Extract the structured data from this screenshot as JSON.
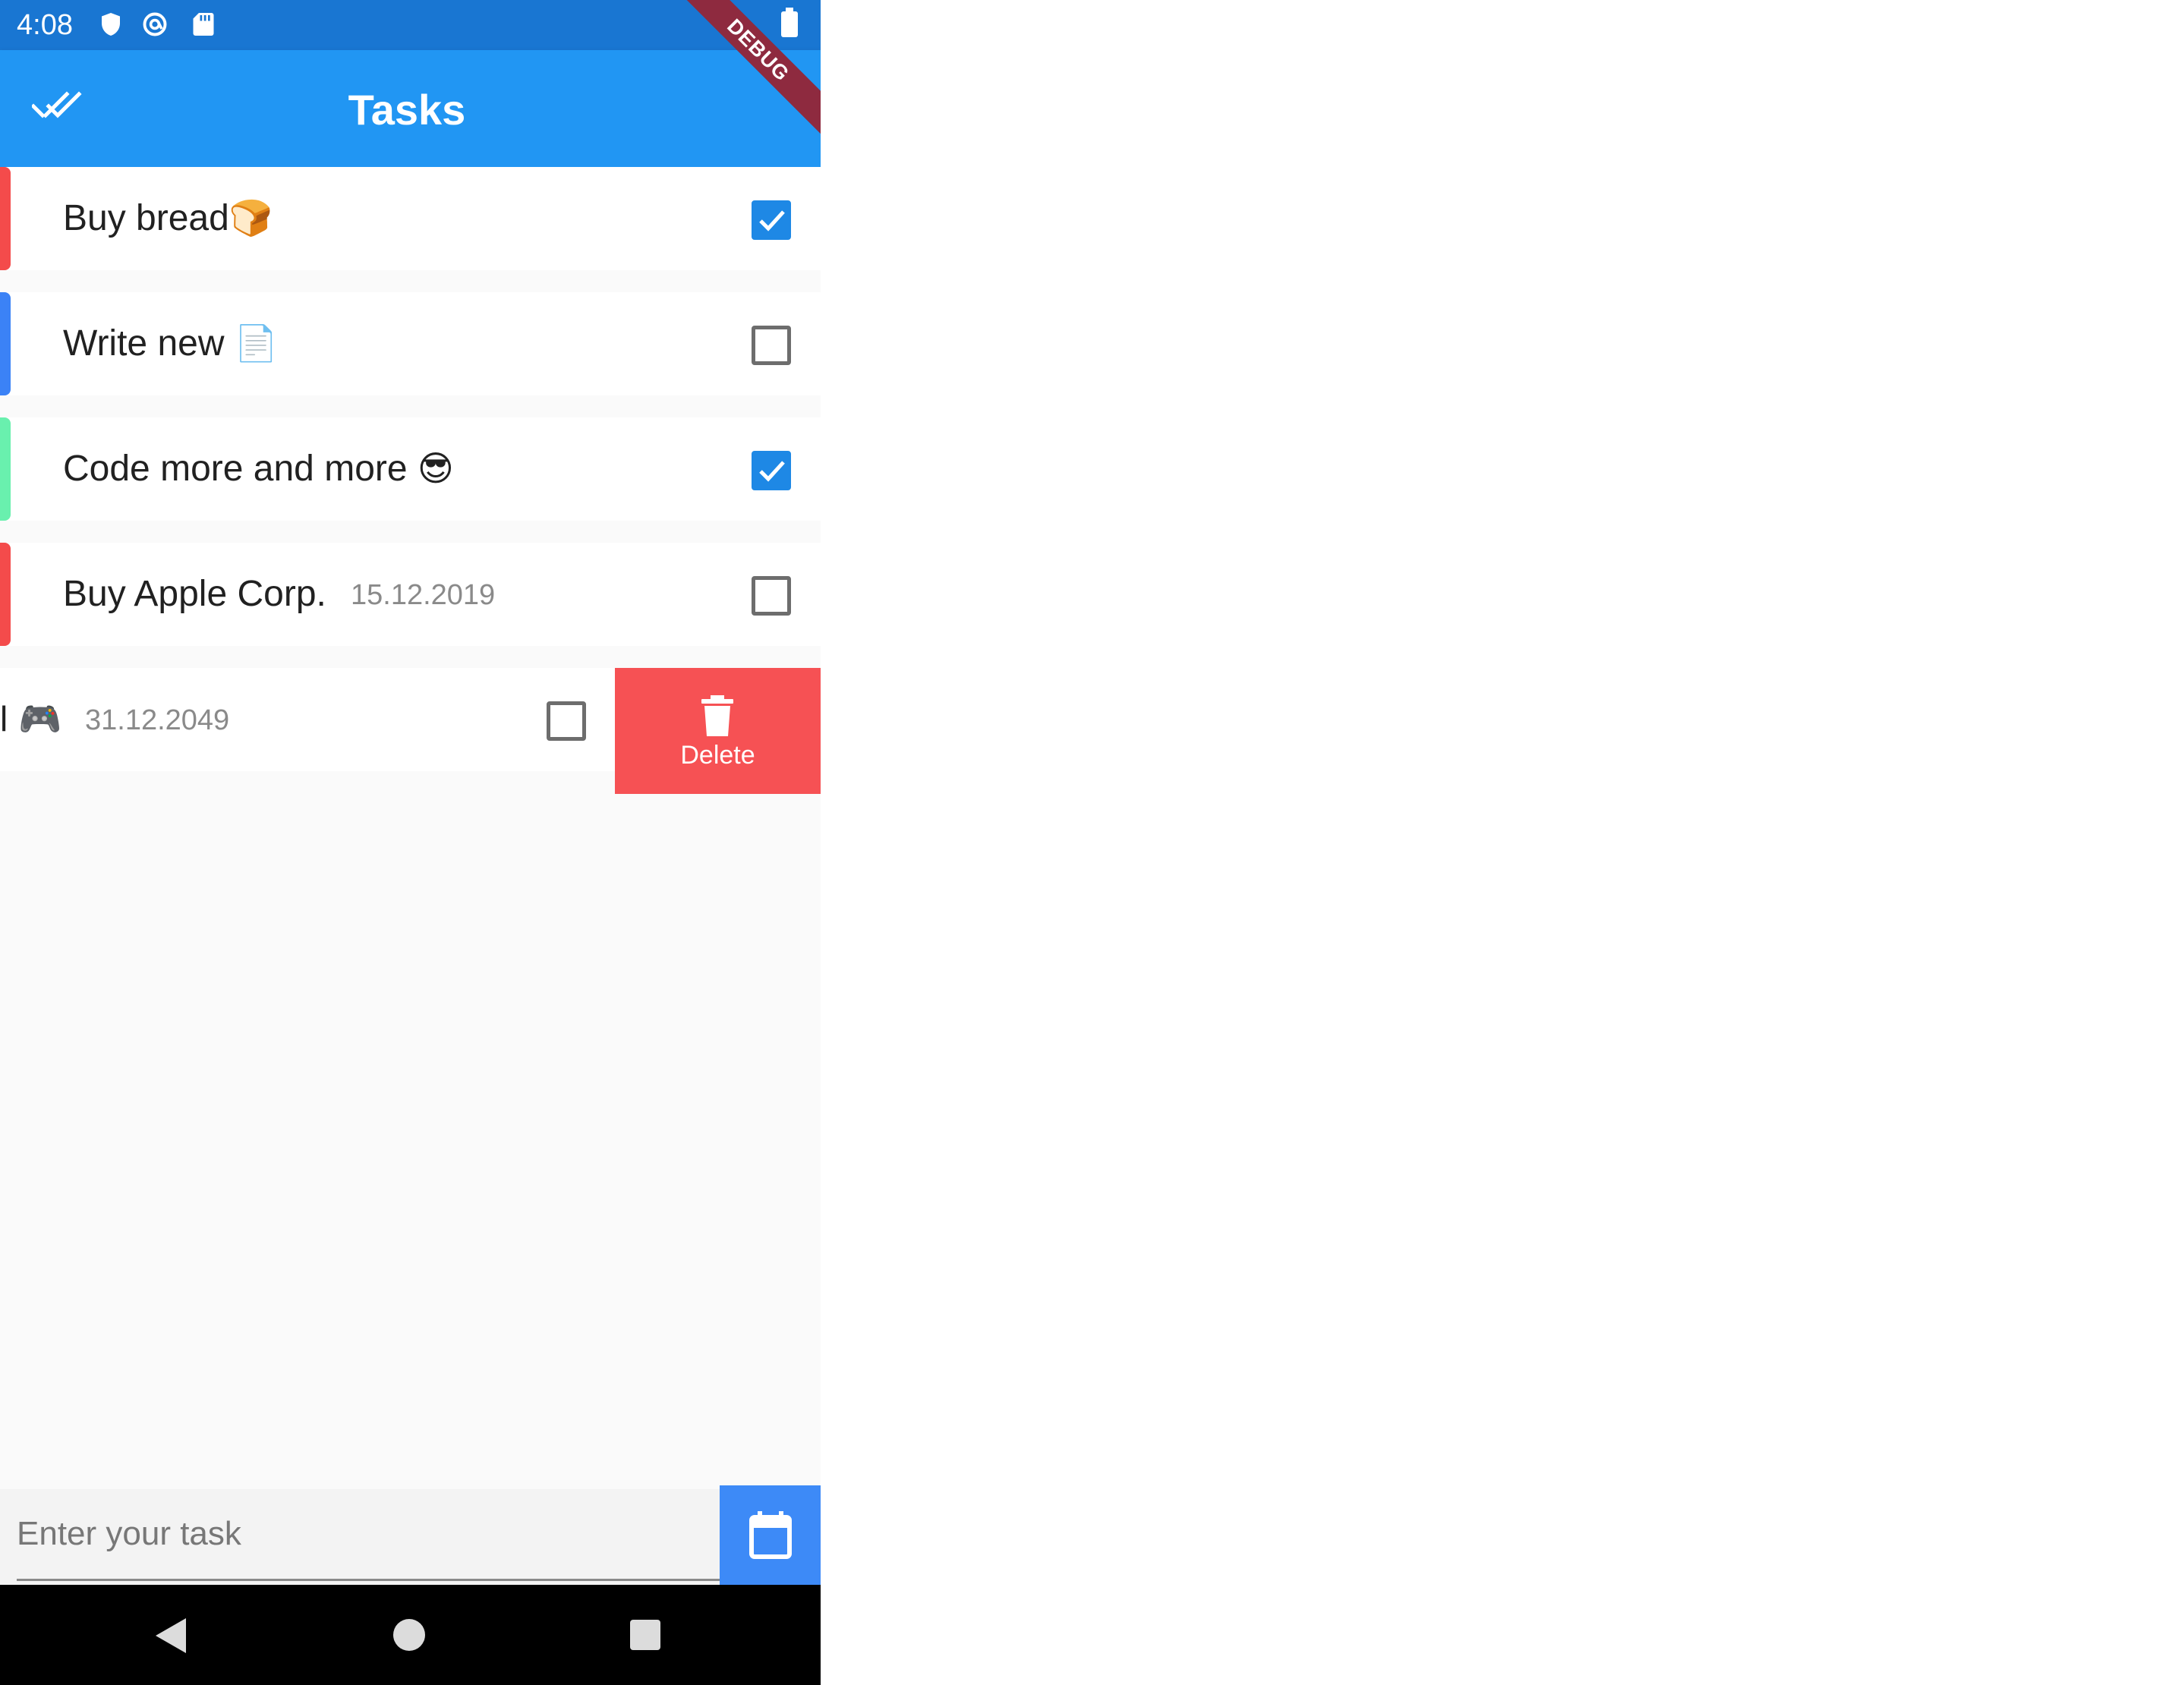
{
  "status_bar": {
    "time": "4:08",
    "icons": [
      "shield-icon",
      "at-sign-icon",
      "sd-card-icon",
      "battery-icon"
    ]
  },
  "app_bar": {
    "title": "Tasks",
    "action_icon": "done-all-icon",
    "debug_banner": "DEBUG",
    "color": "#2196f3"
  },
  "tasks": [
    {
      "title": "Buy bread",
      "emoji": "🍞",
      "date": "",
      "checked": true,
      "stripe_color": "#f44b4b"
    },
    {
      "title": "Write new",
      "emoji": "📄",
      "date": "",
      "checked": false,
      "stripe_color": "#3b82f6"
    },
    {
      "title": "Code more and more",
      "emoji": "😎",
      "date": "",
      "checked": true,
      "stripe_color": "#69f0ae"
    },
    {
      "title": "Buy Apple Corp.",
      "emoji": "",
      "date": "15.12.2019",
      "checked": false,
      "stripe_color": "#f44b4b"
    },
    {
      "title": "l",
      "emoji": "🎮",
      "date": "31.12.2049",
      "checked": false,
      "stripe_color": ""
    }
  ],
  "swipe_action": {
    "label": "Delete",
    "icon": "trash-icon",
    "color": "#f65154"
  },
  "input": {
    "placeholder": "Enter your task",
    "value": ""
  },
  "calendar_button": {
    "icon": "calendar-icon",
    "color": "#3d8af7"
  },
  "nav_bar": {
    "icons": [
      "back-icon",
      "home-icon",
      "recents-icon"
    ]
  },
  "colors": {
    "accent": "#1e88e5",
    "background": "#fafafa"
  }
}
